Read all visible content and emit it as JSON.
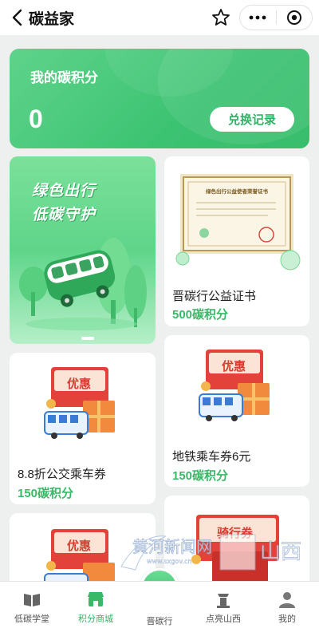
{
  "header": {
    "title": "碳益家",
    "back_icon": "chevron-left-icon",
    "star_icon": "star-icon",
    "more_icon": "more-dots-icon",
    "close_icon": "target-close-icon"
  },
  "points_card": {
    "label": "我的碳积分",
    "value": "0",
    "button_label": "兑换记录"
  },
  "banner": {
    "line1": "绿色出行",
    "line2": "低碳守护"
  },
  "products": [
    {
      "name": "晋碳行公益证书",
      "price": "500碳积分",
      "image": "certificate",
      "cert_title": "绿色出行公益使者荣誉证书"
    },
    {
      "name": "8.8折公交乘车券",
      "price": "150碳积分",
      "image": "coupon-bus",
      "tag": "优惠"
    },
    {
      "name": "地铁乘车券6元",
      "price": "150碳积分",
      "image": "coupon-bus",
      "tag": "优惠"
    },
    {
      "name": "",
      "price": "",
      "image": "coupon-bus",
      "tag": "优惠"
    },
    {
      "name": "",
      "price": "",
      "image": "coupon-red",
      "tag": "骑行券"
    }
  ],
  "tabs": [
    {
      "label": "低碳学堂",
      "icon": "book-icon",
      "active": false
    },
    {
      "label": "积分商城",
      "icon": "shop-icon",
      "active": true
    },
    {
      "label": "晋碳行",
      "icon": "leaf-icon",
      "active": false
    },
    {
      "label": "点亮山西",
      "icon": "landmark-icon",
      "active": false
    },
    {
      "label": "我的",
      "icon": "user-icon",
      "active": false
    }
  ],
  "watermark": {
    "text": "黄河新闻网",
    "sub": "www.sxgov.cn",
    "brand": "山西"
  },
  "colors": {
    "accent": "#39b968",
    "card_green": "#3cc372",
    "coupon_red": "#e3423a"
  }
}
